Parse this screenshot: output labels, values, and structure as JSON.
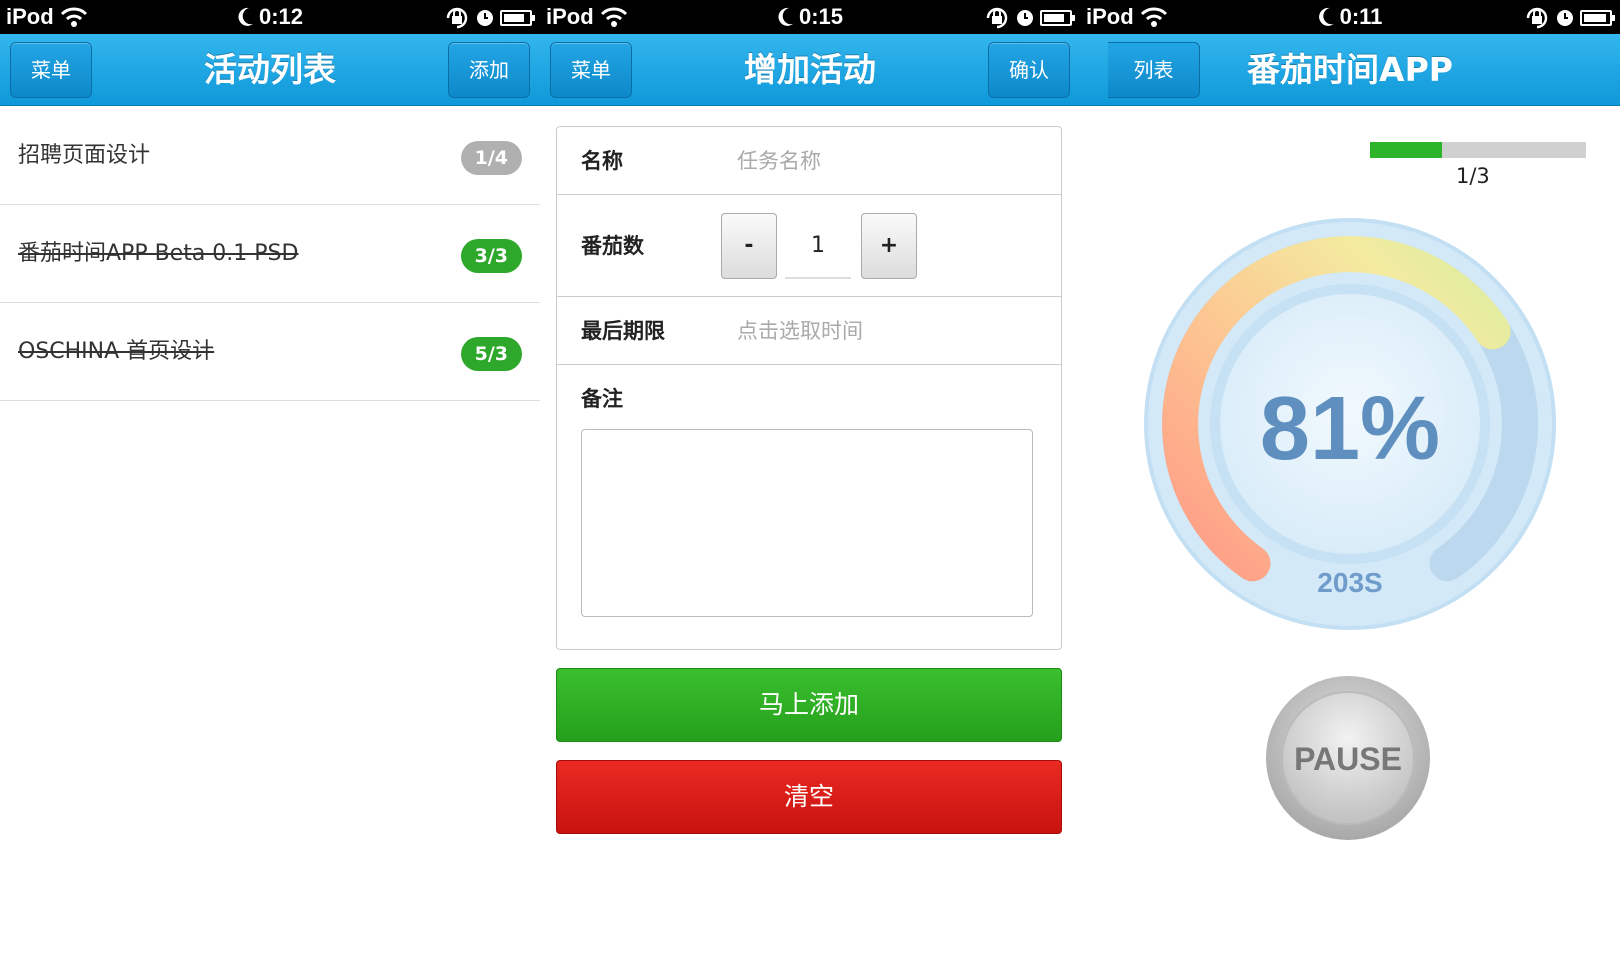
{
  "screens": [
    {
      "status": {
        "device": "iPod",
        "time": "0:12"
      },
      "nav": {
        "title": "活动列表",
        "left_button": "菜单",
        "right_button": "添加"
      },
      "items": [
        {
          "title": "招聘页面设计",
          "badge": "1/4",
          "done": false
        },
        {
          "title": "番茄时间APP Beta 0.1 PSD",
          "badge": "3/3",
          "done": true
        },
        {
          "title": "OSCHINA 首页设计",
          "badge": "5/3",
          "done": true
        }
      ]
    },
    {
      "status": {
        "device": "iPod",
        "time": "0:15"
      },
      "nav": {
        "title": "增加活动",
        "left_button": "菜单",
        "right_button": "确认"
      },
      "form": {
        "name_label": "名称",
        "name_placeholder": "任务名称",
        "count_label": "番茄数",
        "minus": "-",
        "count_value": "1",
        "plus": "+",
        "deadline_label": "最后期限",
        "deadline_placeholder": "点击选取时间",
        "note_label": "备注"
      },
      "add_button": "马上添加",
      "clear_button": "清空"
    },
    {
      "status": {
        "device": "iPod",
        "time": "0:11"
      },
      "nav": {
        "title": "番茄时间APP",
        "back_button": "列表"
      },
      "progress": {
        "label": "1/3",
        "fraction": 0.333
      },
      "gauge": {
        "percent_text": "81%",
        "percent": 81,
        "seconds_text": "203S"
      },
      "pause_button": "PAUSE"
    }
  ],
  "colors": {
    "nav_blue": "#1aa7e6",
    "badge_green": "#2ea82a",
    "badge_gray": "#b0b0b0",
    "add_green": "#2fb025",
    "clear_red": "#dc1e19",
    "gauge_text": "#5f8fbf"
  },
  "icons": [
    "wifi-icon",
    "moon-icon",
    "rotation-lock-icon",
    "alarm-icon",
    "battery-icon"
  ]
}
